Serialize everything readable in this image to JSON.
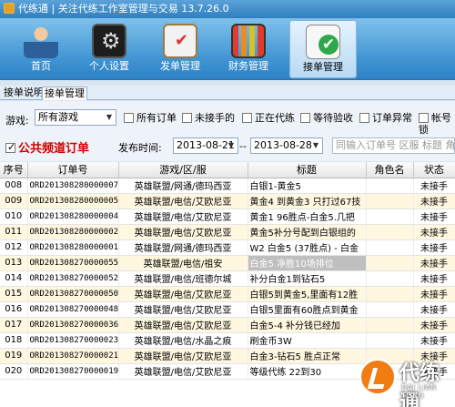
{
  "window": {
    "title": "代练通 | 关注代练工作室管理与交易 13.7.26.0"
  },
  "ribbon": [
    {
      "label": "首页",
      "icon": "home-icon"
    },
    {
      "label": "个人设置",
      "icon": "settings-icon"
    },
    {
      "label": "发单管理",
      "icon": "clipboard-icon"
    },
    {
      "label": "财务管理",
      "icon": "finance-chart-icon"
    },
    {
      "label": "接单管理",
      "icon": "accept-order-icon",
      "active": true
    }
  ],
  "tabs": [
    {
      "label": "接单说明"
    },
    {
      "label": "接单管理",
      "selected": true
    }
  ],
  "filters": {
    "game_label": "游戏:",
    "game_value": "所有游戏",
    "checkboxes": [
      "所有订单",
      "未接手的",
      "正在代练",
      "等待验收",
      "订单异常",
      "帐号锁"
    ],
    "public_channel": "公共频道订单",
    "date_label": "发布时间:",
    "date_from": "2013-08-21",
    "date_sep": "--",
    "date_to": "2013-08-28",
    "search_placeholder": "同输入订单号 区服 标题 角色"
  },
  "table": {
    "columns": [
      "序号",
      "订单号",
      "游戏/区/服",
      "标题",
      "角色名",
      "状态"
    ],
    "rows": [
      [
        "008",
        "ORD2013082800000077",
        "英雄联盟/网通/德玛西亚",
        "白银1-黄金5",
        "",
        "未接手"
      ],
      [
        "009",
        "ORD2013082800000056",
        "英雄联盟/电信/艾欧尼亚",
        "黄金4 到黄金3 只打过67技",
        "",
        "未接手"
      ],
      [
        "010",
        "ORD2013082800000049",
        "英雄联盟/电信/艾欧尼亚",
        "黄金1 96胜点-白金5.几把",
        "",
        "未接手"
      ],
      [
        "011",
        "ORD2013082800000025",
        "英雄联盟/电信/艾欧尼亚",
        "黄金5补分号配到白银组的",
        "",
        "未接手"
      ],
      [
        "012",
        "ORD2013082800000010",
        "英雄联盟/网通/德玛西亚",
        "W2 白金5 (37胜点) - 白金",
        "",
        "未接手"
      ],
      [
        "013",
        "ORD2013082700000558",
        "英雄联盟/电信/祖安",
        "白金5 净胜10场排位",
        "",
        "未接手"
      ],
      [
        "014",
        "ORD2013082700000527",
        "英雄联盟/电信/班德尔城",
        "补分白金1到钻石5",
        "",
        "未接手"
      ],
      [
        "015",
        "ORD2013082700000502",
        "英雄联盟/电信/艾欧尼亚",
        "白银5到黄金5,里面有12胜",
        "",
        "未接手"
      ],
      [
        "016",
        "ORD2013082700000486",
        "英雄联盟/电信/艾欧尼亚",
        "白银5里面有60胜点到黄金",
        "",
        "未接手"
      ],
      [
        "017",
        "ORD2013082700000369",
        "英雄联盟/电信/艾欧尼亚",
        "白金5-4  补分钱已经加",
        "",
        "未接手"
      ],
      [
        "018",
        "ORD2013082700000235",
        "英雄联盟/电信/水晶之痕",
        "刷金币3W",
        "",
        "未接手"
      ],
      [
        "019",
        "ORD2013082700000214",
        "英雄联盟/电信/艾欧尼亚",
        "白金3-钻石5 胜点正常",
        "",
        "未接手"
      ],
      [
        "020",
        "ORD2013082700000190",
        "英雄联盟/电信/艾欧尼亚",
        "等级代练 22到30",
        "",
        "未接手"
      ]
    ]
  },
  "watermark": {
    "text": "代练通",
    "sub": "DAI LIAN TONG"
  }
}
